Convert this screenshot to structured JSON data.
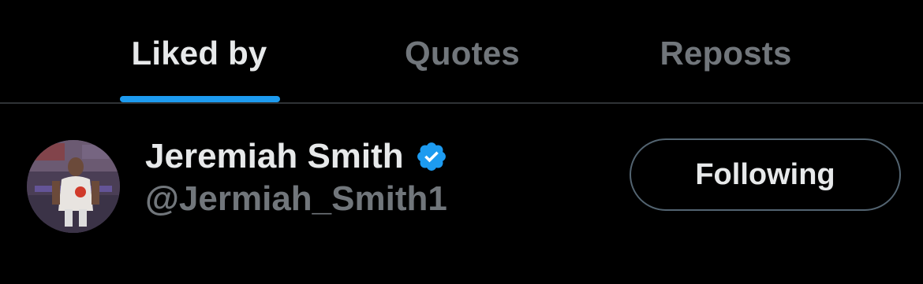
{
  "tabs": [
    {
      "label": "Liked by",
      "active": true
    },
    {
      "label": "Quotes",
      "active": false
    },
    {
      "label": "Reposts",
      "active": false
    }
  ],
  "user": {
    "display_name": "Jeremiah Smith",
    "handle": "@Jermiah_Smith1",
    "verified": true,
    "avatar": "person-photo",
    "follow_button_label": "Following"
  },
  "colors": {
    "background": "#000000",
    "primary_text": "#e7e9ea",
    "secondary_text": "#71767b",
    "accent": "#1d9bf0",
    "divider": "#2f3336",
    "button_border": "#536471"
  },
  "icons": {
    "verified": "verified-badge-icon"
  }
}
